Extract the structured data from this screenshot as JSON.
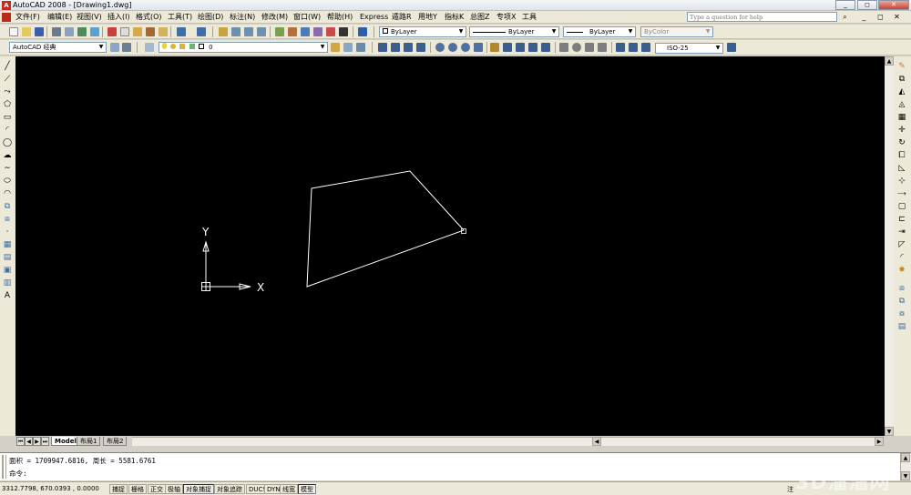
{
  "window": {
    "title": "AutoCAD 2008 - [Drawing1.dwg]",
    "app_icon": "autocad-icon",
    "minimize": "_",
    "restore": "◻",
    "close": "✕"
  },
  "menubar": {
    "items": [
      "文件(F)",
      "编辑(E)",
      "视图(V)",
      "插入(I)",
      "格式(O)",
      "工具(T)",
      "绘图(D)",
      "标注(N)",
      "修改(M)",
      "窗口(W)",
      "帮助(H)",
      "Express",
      "遁路R",
      "用地Y",
      "指标K",
      "总图Z",
      "专项X",
      "工具"
    ],
    "help_placeholder": "Type a question for help"
  },
  "toolbar": {
    "workspace": "AutoCAD 经典",
    "layer": "0",
    "color": "ByLayer",
    "linetype": "ByLayer",
    "lineweight": "ByLayer",
    "plotstyle": "ByColor",
    "dimstyle": "ISO-25"
  },
  "canvas": {
    "background": "#000000",
    "ucs_x_label": "X",
    "ucs_y_label": "Y"
  },
  "tabs": [
    "Model",
    "布局1",
    "布局2"
  ],
  "command": {
    "history": "面积 = 1709947.6816, 周长 = 5581.6761",
    "prompt": "命令:"
  },
  "statusbar": {
    "coords": "3312.7798,  670.0393  , 0.0000",
    "buttons": [
      "捕捉",
      "栅格",
      "正交",
      "极轴",
      "对象捕捉",
      "对象追踪",
      "DUCS",
      "DYN",
      "线宽",
      "模型"
    ],
    "note": "注"
  },
  "watermark": "3D溜溜网"
}
